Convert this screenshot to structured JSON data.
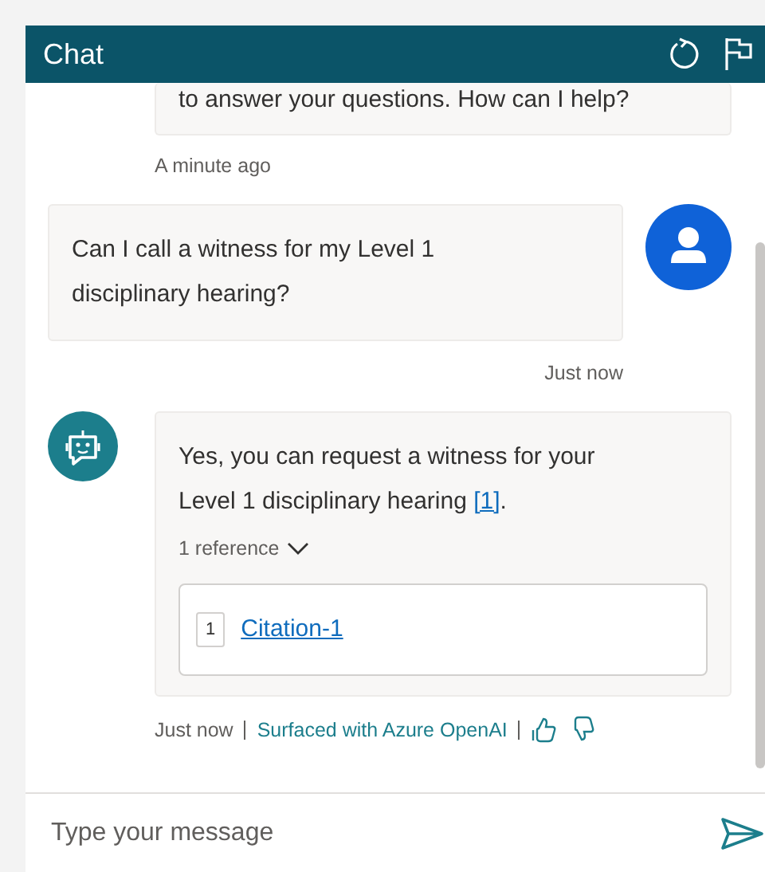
{
  "header": {
    "title": "Chat"
  },
  "messages": [
    {
      "kind": "bot_tail",
      "text": "to answer your questions. How can I help?",
      "time": "A minute ago"
    },
    {
      "kind": "user",
      "text": "Can I call a witness for my Level 1 disciplinary hearing?",
      "time": "Just now"
    },
    {
      "kind": "bot",
      "text_before": "Yes, you can request a witness for your Level 1 disciplinary hearing ",
      "citation": "[1]",
      "text_after": ".",
      "references_label": "1 reference",
      "references_expanded": true,
      "references": [
        {
          "number": "1",
          "title": "Citation-1"
        }
      ],
      "time": "Just now",
      "attribution": "Surfaced with Azure OpenAI"
    }
  ],
  "composer": {
    "placeholder": "Type your message"
  }
}
